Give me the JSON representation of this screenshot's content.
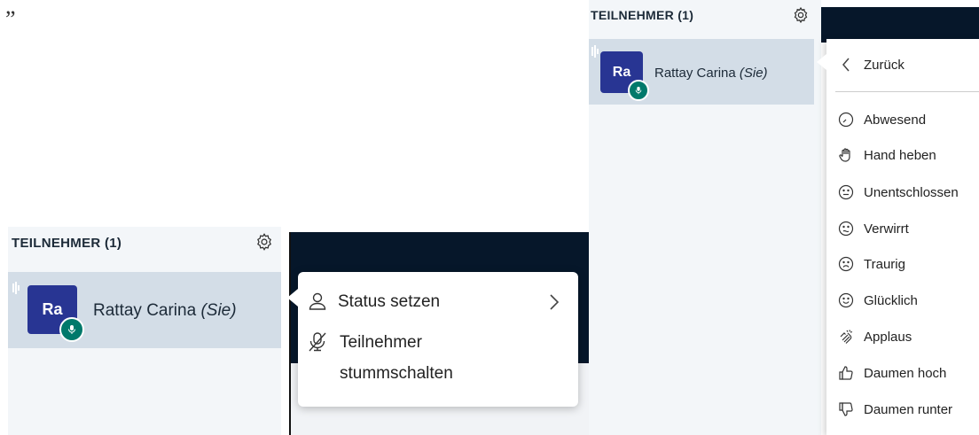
{
  "left_panel": {
    "header": "TEILNEHMER (1)",
    "user": {
      "initials": "Ra",
      "name": "Rattay Carina ",
      "self_label": "(Sie)"
    },
    "context_menu": {
      "items": [
        {
          "icon": "user-icon",
          "label": "Status setzen",
          "has_submenu": true
        },
        {
          "icon": "mic-off-icon",
          "label": "Teilnehmer stummschalten",
          "label_line1": "Teilnehmer",
          "label_line2": "stummschalten"
        }
      ]
    }
  },
  "right_panel": {
    "header": "TEILNEHMER (1)",
    "user": {
      "initials": "Ra",
      "name": "Rattay Carina ",
      "self_label": "(Sie)"
    },
    "status_menu": {
      "back_label": "Zurück",
      "items": [
        {
          "icon": "clock-icon",
          "label": "Abwesend"
        },
        {
          "icon": "hand-icon",
          "label": "Hand heben"
        },
        {
          "icon": "undecided-face-icon",
          "label": "Unentschlossen"
        },
        {
          "icon": "confused-face-icon",
          "label": "Verwirrt"
        },
        {
          "icon": "sad-face-icon",
          "label": "Traurig"
        },
        {
          "icon": "happy-face-icon",
          "label": "Glücklich"
        },
        {
          "icon": "applause-icon",
          "label": "Applaus"
        },
        {
          "icon": "thumbs-up-icon",
          "label": "Daumen hoch"
        },
        {
          "icon": "thumbs-down-icon",
          "label": "Daumen runter"
        }
      ]
    }
  },
  "colors": {
    "avatar": "#283593",
    "mic_badge": "#00796b",
    "selected_row": "#d3dde7",
    "panel_bg": "#f3f6f9",
    "dark_area": "#06172a"
  }
}
